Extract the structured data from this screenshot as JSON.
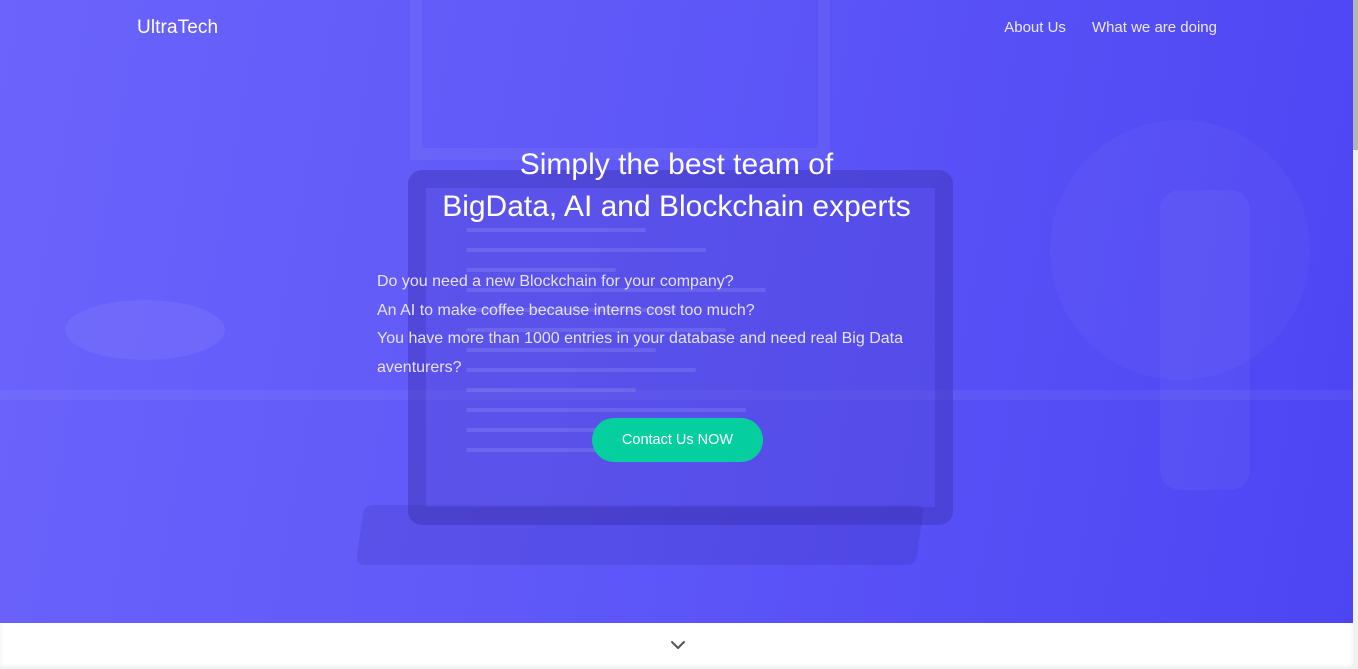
{
  "header": {
    "brand": "UltraTech",
    "nav": [
      {
        "label": "About Us"
      },
      {
        "label": "What we are doing"
      }
    ]
  },
  "hero": {
    "headline_line1": "Simply the best team of",
    "headline_line2": "BigData, AI and Blockchain experts",
    "questions": [
      "Do you need a new Blockchain for your company?",
      "An AI to make coffee because interns cost too much?",
      "You have more than 1000 entries in your database and need real Big Data aventurers?"
    ],
    "cta_label": "Contact Us NOW"
  },
  "icons": {
    "scroll_down": "chevron-down-icon"
  },
  "colors": {
    "hero_gradient_start": "#6b63fb",
    "hero_gradient_end": "#4d45f3",
    "cta": "#05cf9e",
    "text": "#ffffff"
  }
}
